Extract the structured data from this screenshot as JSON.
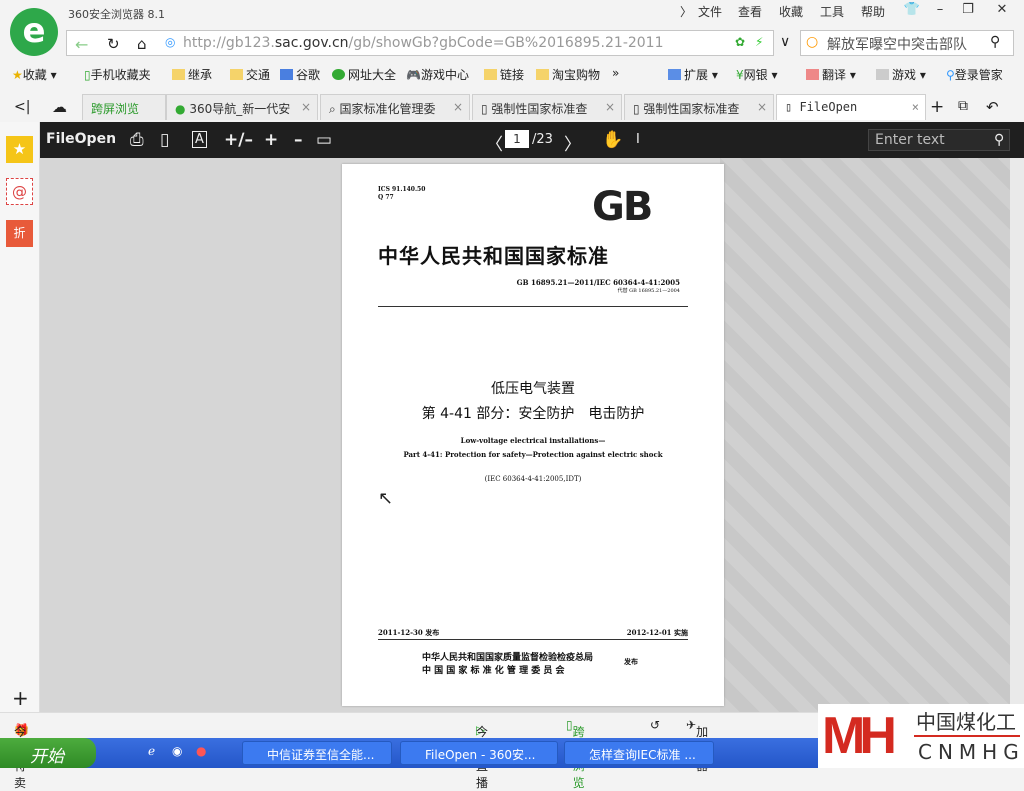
{
  "app": {
    "title": "360安全浏览器 8.1",
    "menu": [
      "文件",
      "查看",
      "收藏",
      "工具",
      "帮助"
    ]
  },
  "address": {
    "url_prefix": "http://gb123.",
    "url_host": "sac.gov.cn",
    "url_path": "/gb/showGb?gbCode=GB%2016895.21-2011",
    "search_value": "解放军曝空中突击部队"
  },
  "bookmarks": [
    "收藏",
    "手机收藏夹",
    "继承",
    "交通",
    "谷歌",
    "网址大全",
    "游戏中心",
    "链接",
    "淘宝购物",
    "扩展",
    "网银",
    "翻译",
    "游戏",
    "登录管家"
  ],
  "tabs": [
    {
      "label": "跨屏浏览"
    },
    {
      "label": "360导航_新一代安"
    },
    {
      "label": "国家标准化管理委"
    },
    {
      "label": "强制性国家标准查"
    },
    {
      "label": "强制性国家标准查"
    },
    {
      "label": "FileOpen"
    }
  ],
  "viewer": {
    "brand": "FileOpen",
    "page_current": "1",
    "page_total": "/23",
    "find_placeholder": "Enter text"
  },
  "document": {
    "ics": "ICS 91.140.50",
    "q": "Q 77",
    "logo": "GB",
    "title": "中华人民共和国国家标准",
    "code": "GB 16895.21—2011/IEC 60364-4-41:2005",
    "replaces": "代替 GB 16895.21—2004",
    "cn_title1": "低压电气装置",
    "cn_title2": "第 4-41 部分：安全防护　电击防护",
    "en_title1": "Low-voltage electrical installations—",
    "en_title2": "Part 4-41: Protection for safety—Protection against electric shock",
    "idt": "(IEC 60364-4-41:2005,IDT)",
    "issued": "2011-12-30 发布",
    "implemented": "2012-12-01 实施",
    "issuer1": "中华人民共和国国家质量监督检验检疫总局",
    "issuer2": "中 国 国 家 标 准 化 管 理 委 员 会",
    "issue_word": "发布"
  },
  "status": {
    "left": "今日特卖",
    "live": "今日直播",
    "cross": "跨屏浏览",
    "accel": "加速器"
  },
  "taskbar": {
    "start": "开始",
    "tasks": [
      "中信证券至信全能...",
      "FileOpen - 360安...",
      "怎样查询IEC标准 ..."
    ]
  },
  "watermark": {
    "cn": "中国煤化工",
    "en": "CNMHG",
    "logo": "MH"
  }
}
